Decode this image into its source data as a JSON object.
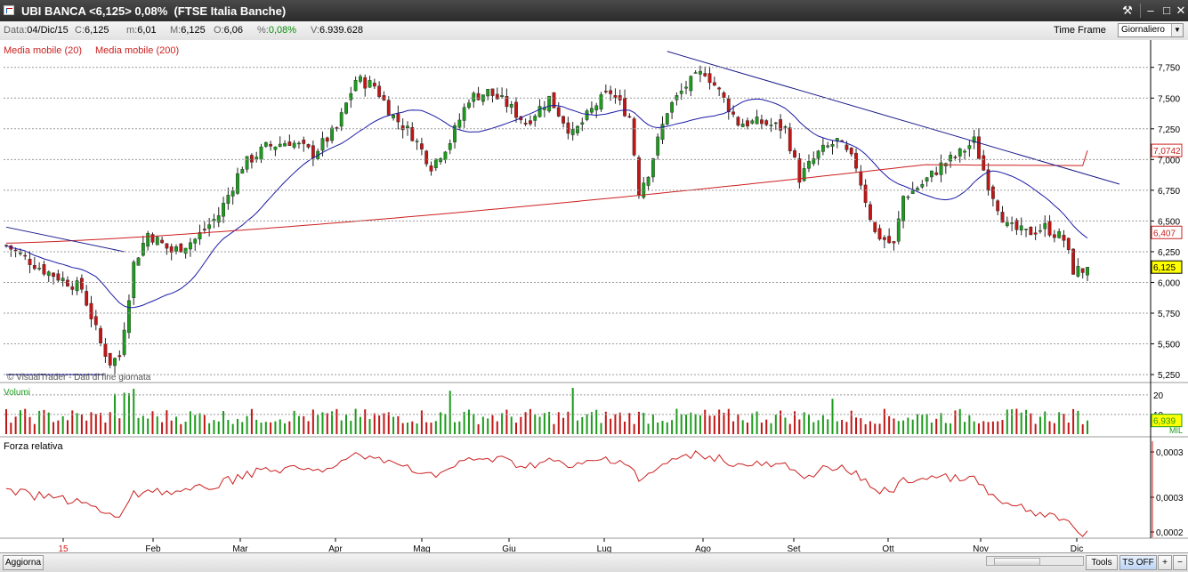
{
  "window": {
    "title": "UBI BANCA <6,125> 0,08%  (FTSE Italia Banche)",
    "buttons": [
      "tools-icon",
      "minimize-icon",
      "maximize-icon",
      "close-icon"
    ]
  },
  "infobar": {
    "data_label": "Data:",
    "data_value": "04/Dic/15",
    "c_label": "C:",
    "c_value": "6,125",
    "m_label": "m:",
    "m_value": "6,01",
    "M_label": "M:",
    "M_value": "6,125",
    "o_label": "O:",
    "o_value": "6,06",
    "pct_label": "%:",
    "pct_value": "0,08%",
    "v_label": "V:",
    "v_value": "6.939.628",
    "time_frame_label": "Time Frame",
    "time_frame_value": "Giornaliero"
  },
  "bottom": {
    "refresh_label": "Aggiorna",
    "tools_label": "Tools",
    "ts_label": "TS OFF",
    "plus": "+",
    "minus": "−"
  },
  "colors": {
    "up": "#1c9b1c",
    "down": "#c11616",
    "ma20": "#1a1aa6",
    "ma200": "#cc1f1f",
    "trend": "#1a1a8a",
    "rs": "#cc1f1f"
  },
  "chart_data": {
    "type": "candlestick",
    "price_panel": {
      "legend": [
        "Media mobile (20)",
        "Media mobile (200)"
      ],
      "watermark": "© VisualTrader - Dati di fine giornata",
      "yticks": [
        "7,750",
        "7,500",
        "7,250",
        "7,000",
        "6,750",
        "6,500",
        "6,250",
        "6,000",
        "5,750",
        "5,500",
        "5,250"
      ],
      "ylim": [
        5.2,
        7.9
      ],
      "value_tags": [
        {
          "label": "7,0742",
          "value": 7.0742,
          "color": "#cc1f1f"
        },
        {
          "label": "6,407",
          "value": 6.407,
          "color": "#cc1f1f"
        },
        {
          "label": "6,125",
          "value": 6.125,
          "color": "#000000"
        }
      ],
      "last_close": 6.125,
      "ma20_last": 6.407,
      "ma200_last": 7.0742
    },
    "volume_panel": {
      "label": "Volumi",
      "yticks": [
        "20",
        "10"
      ],
      "value_tag": "6,939",
      "unit": "MIL",
      "last": 6.939
    },
    "rs_panel": {
      "label": "Forza relativa",
      "yticks": [
        "0,0003",
        "0,0003",
        "0,0002"
      ]
    },
    "x_labels": [
      "15",
      "Feb",
      "Mar",
      "Apr",
      "Mag",
      "Giu",
      "Lug",
      "Ago",
      "Set",
      "Ott",
      "Nov",
      "Dic"
    ]
  }
}
